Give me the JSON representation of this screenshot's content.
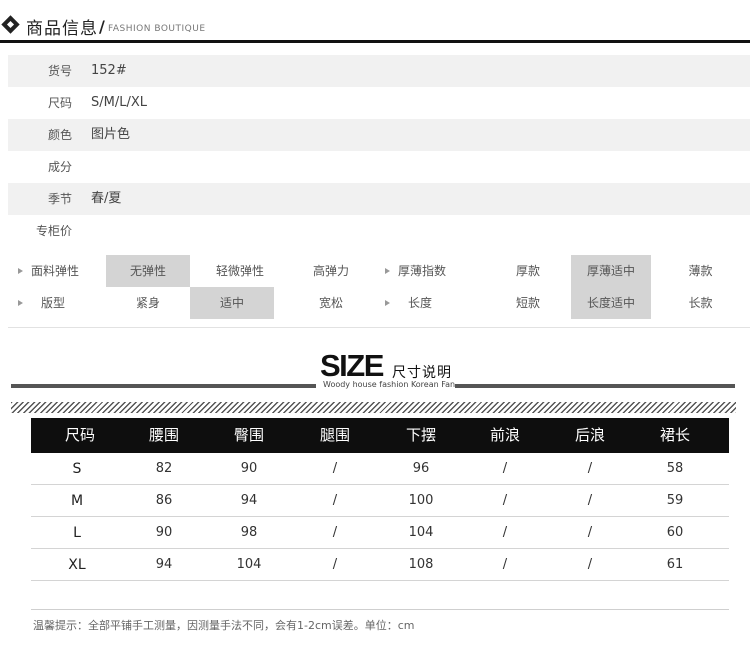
{
  "header": {
    "title": "商品信息",
    "slash": "/",
    "subtitle": "FASHION BOUTIQUE"
  },
  "info_rows": [
    {
      "label": "货号",
      "value": "152#"
    },
    {
      "label": "尺码",
      "value": "S/M/L/XL"
    },
    {
      "label": "颜色",
      "value": "图片色"
    },
    {
      "label": "成分",
      "value": ""
    },
    {
      "label": "季节",
      "value": "春/夏"
    },
    {
      "label": "专柜价",
      "value": ""
    }
  ],
  "attributes": {
    "row1": {
      "elastic_label": "面料弹性",
      "elastic_options": [
        "无弹性",
        "轻微弹性",
        "高弹力"
      ],
      "elastic_selected": "无弹性",
      "thickness_label": "厚薄指数",
      "thickness_options": [
        "厚款",
        "厚薄适中",
        "薄款"
      ],
      "thickness_selected": "厚薄适中"
    },
    "row2": {
      "fit_label": "版型",
      "fit_options": [
        "紧身",
        "适中",
        "宽松"
      ],
      "fit_selected": "适中",
      "length_label": "长度",
      "length_options": [
        "短款",
        "长度适中",
        "长款"
      ],
      "length_selected": "长度适中"
    }
  },
  "size_banner": {
    "word": "SIZE",
    "cn": "尺寸说明",
    "en": "Woody house fashion Korean Fan"
  },
  "size_table": {
    "headers": [
      "尺码",
      "腰围",
      "臀围",
      "腿围",
      "下摆",
      "前浪",
      "后浪",
      "裙长"
    ],
    "rows": [
      [
        "S",
        "82",
        "90",
        "/",
        "96",
        "/",
        "/",
        "58"
      ],
      [
        "M",
        "86",
        "94",
        "/",
        "100",
        "/",
        "/",
        "59"
      ],
      [
        "L",
        "90",
        "98",
        "/",
        "104",
        "/",
        "/",
        "60"
      ],
      [
        "XL",
        "94",
        "104",
        "/",
        "108",
        "/",
        "/",
        "61"
      ]
    ]
  },
  "footnote": "温馨提示：全部平铺手工测量，因测量手法不同，会有1-2cm误差。单位：cm",
  "colors": {
    "header_rule": "#111111",
    "row_shade": "#f1f1f1",
    "selected_cell": "#d4d4d4",
    "table_header_bg": "#0e0e0e"
  }
}
